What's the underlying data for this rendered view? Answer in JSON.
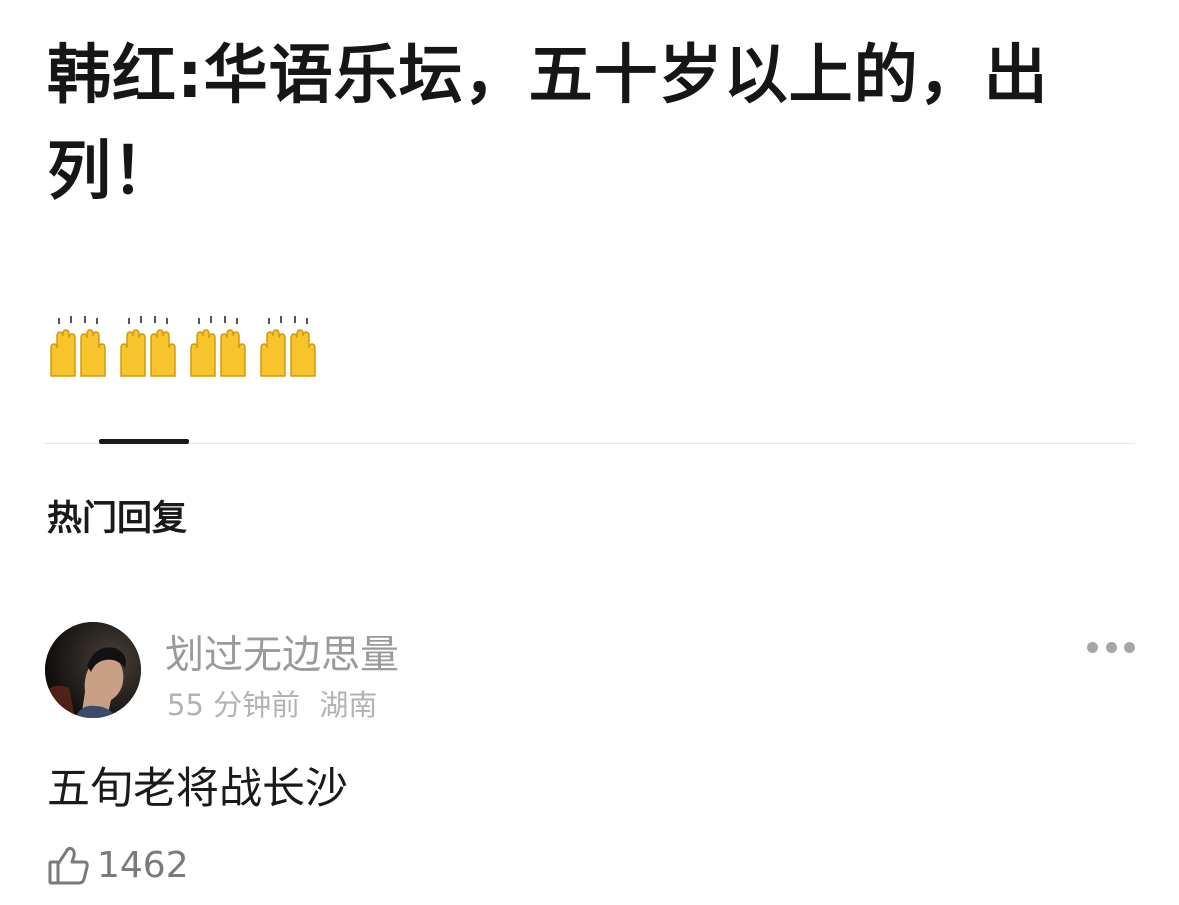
{
  "post": {
    "title": "韩红:华语乐坛，五十岁以上的，出列！",
    "emoji": [
      "raising-hands",
      "raising-hands",
      "raising-hands",
      "raising-hands"
    ]
  },
  "section": {
    "title": "热门回复"
  },
  "comment": {
    "username": "划过无边思量",
    "time": "55 分钟前",
    "location": "湖南",
    "text": "五旬老将战长沙",
    "likes": "1462",
    "avatar_icon": "user-avatar-photo"
  },
  "colors": {
    "text_primary": "#1a1a1a",
    "text_secondary": "#9a9a9a",
    "emoji_yellow": "#f7c52b"
  }
}
